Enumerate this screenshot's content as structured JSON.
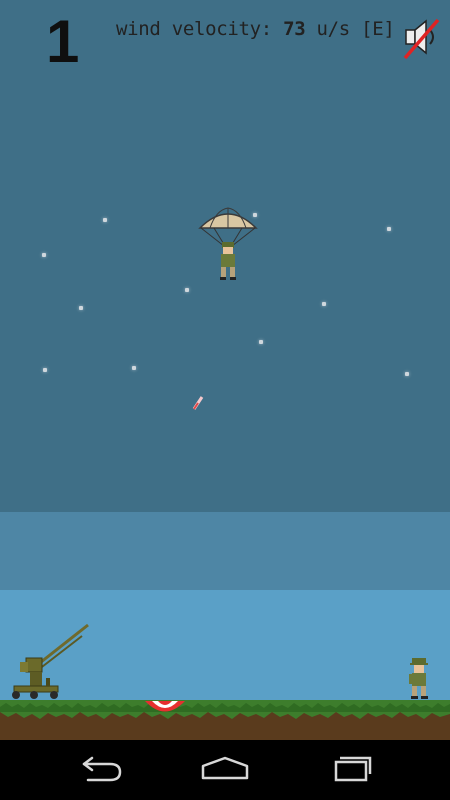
{
  "hud": {
    "score": "1",
    "wind_label": "wind velocity:",
    "wind_value": "73",
    "wind_unit": "u/s [E]"
  },
  "icons": {
    "sound_toggle": "speaker-muted-icon",
    "back": "back-icon",
    "home": "home-icon",
    "recents": "recent-apps-icon"
  },
  "colors": {
    "sky_top": "#3f6f87",
    "sky_mid": "#4e86a5",
    "sky_low": "#5aa0c7",
    "grass": "#3d7d2c",
    "dirt": "#5a3b1d",
    "parachute": "#d9c7a3",
    "soldier_uniform": "#6b7a3a"
  }
}
